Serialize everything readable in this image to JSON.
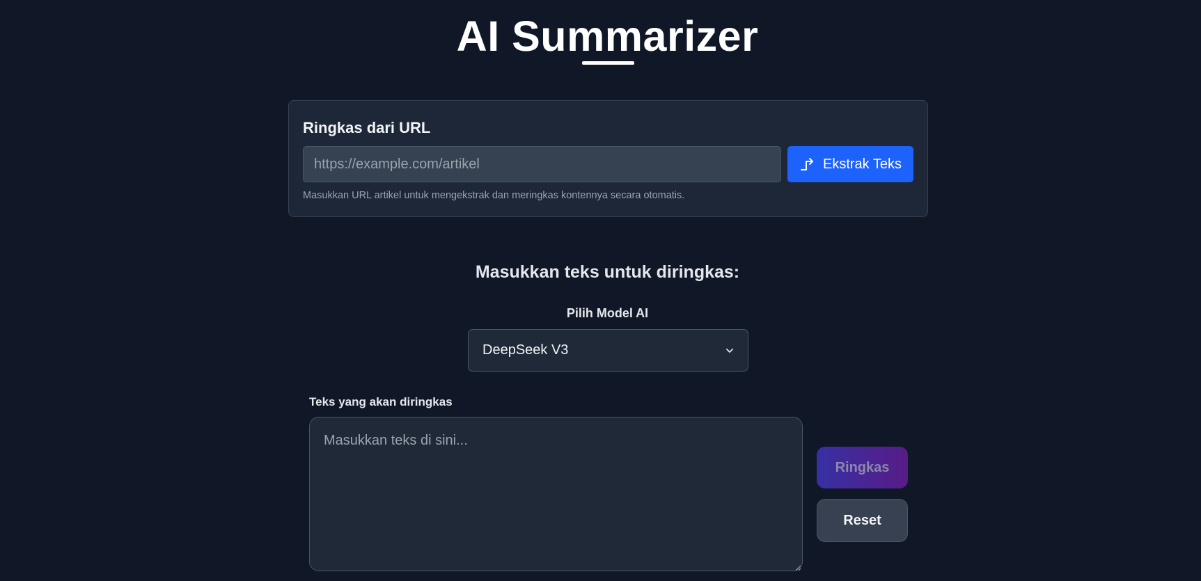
{
  "header": {
    "title": "AI Summarizer"
  },
  "url_card": {
    "title": "Ringkas dari URL",
    "input_placeholder": "https://example.com/artikel",
    "input_value": "",
    "extract_label": "Ekstrak Teks",
    "extract_icon": "share-arrow-icon",
    "help_text": "Masukkan URL artikel untuk mengekstrak dan meringkas kontennya secara otomatis."
  },
  "main": {
    "heading": "Masukkan teks untuk diringkas:",
    "model_label": "Pilih Model AI",
    "model_selected": "DeepSeek V3",
    "text_label": "Teks yang akan diringkas",
    "text_placeholder": "Masukkan teks di sini...",
    "text_value": "",
    "summarize_label": "Ringkas",
    "reset_label": "Reset"
  },
  "colors": {
    "background": "#101828",
    "accent": "#1d62fb",
    "gradient_start": "#3730a3",
    "gradient_end": "#581c87"
  }
}
